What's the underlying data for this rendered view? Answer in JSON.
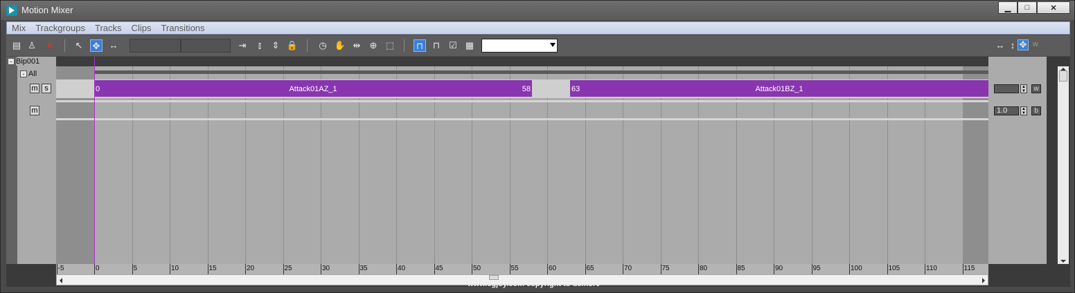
{
  "window": {
    "title": "Motion Mixer",
    "minimize": "▁",
    "maximize": "□",
    "close": "✕"
  },
  "menu": [
    "Mix",
    "Trackgroups",
    "Tracks",
    "Clips",
    "Transitions"
  ],
  "toolbar": {
    "dropdown_value": "",
    "right_label": "w"
  },
  "tracks": {
    "biped": "Bip001",
    "group": "All",
    "m_label": "m",
    "s_label": "s"
  },
  "clips": [
    {
      "name": "Attack01AZ_1",
      "start": 0,
      "end": 58
    },
    {
      "name": "Attack01BZ_1",
      "start": 63,
      "end": ""
    }
  ],
  "right_panel": {
    "weight_value": "",
    "weight_btn": "w",
    "scale_value": "1.0",
    "scale_btn": "b"
  },
  "ruler": {
    "range": [
      -5,
      115
    ],
    "labels": [
      "-5",
      "0",
      "5",
      "10",
      "15",
      "20",
      "25",
      "30",
      "35",
      "40",
      "45",
      "50",
      "55",
      "60",
      "65",
      "70",
      "75",
      "80",
      "85",
      "90",
      "95",
      "100",
      "105",
      "110",
      "115"
    ]
  },
  "watermark": "www.cgjoy.com  copyright to  ucmore",
  "colors": {
    "clip": "#8a35b0",
    "playhead": "#b030d0",
    "active_tool": "#3d7fd6"
  }
}
